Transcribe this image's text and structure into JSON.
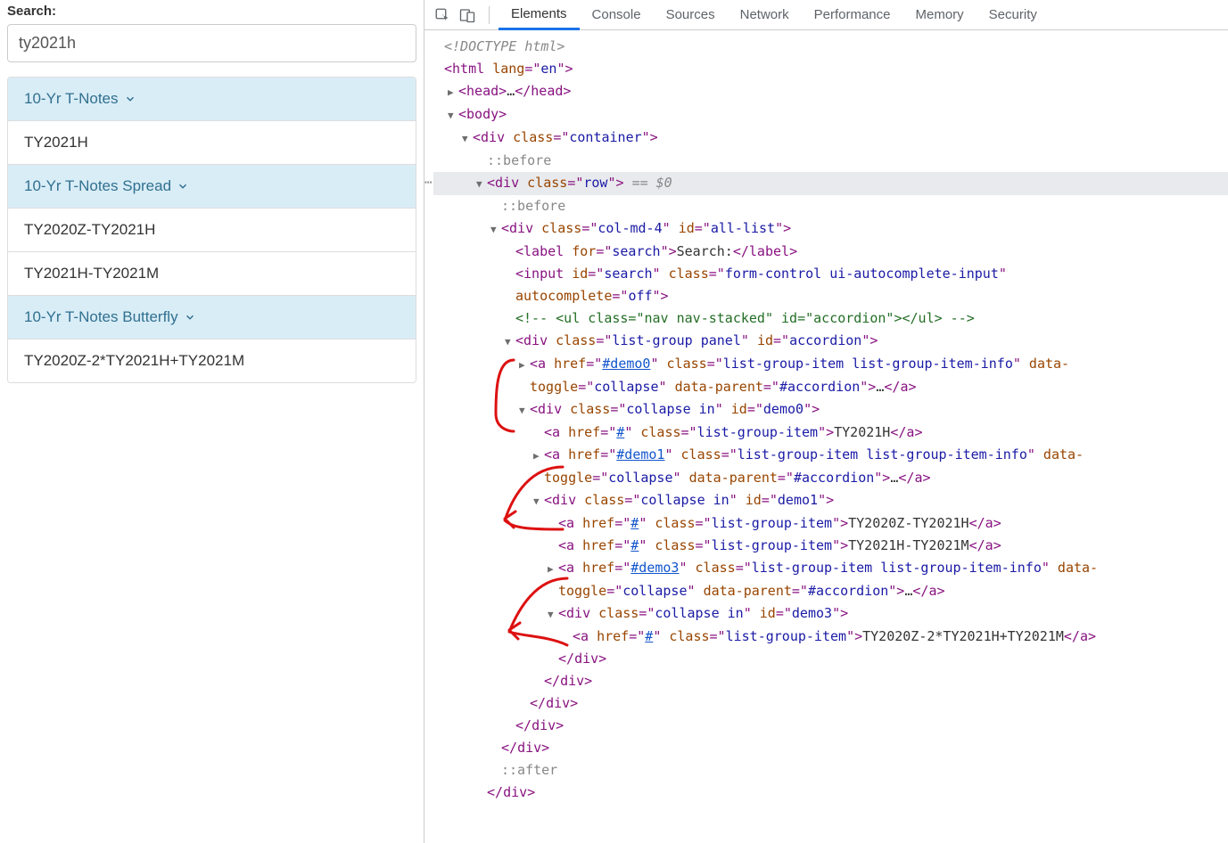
{
  "search": {
    "label": "Search:",
    "value": "ty2021h"
  },
  "accordion": {
    "groups": [
      {
        "header": "10-Yr T-Notes",
        "items": [
          "TY2021H"
        ]
      },
      {
        "header": "10-Yr T-Notes Spread",
        "items": [
          "TY2020Z-TY2021H",
          "TY2021H-TY2021M"
        ]
      },
      {
        "header": "10-Yr T-Notes Butterfly",
        "items": [
          "TY2020Z-2*TY2021H+TY2021M"
        ]
      }
    ]
  },
  "devtools": {
    "tabs": [
      "Elements",
      "Console",
      "Sources",
      "Network",
      "Performance",
      "Memory",
      "Security"
    ],
    "active_tab": "Elements",
    "selected_expr": "== $0"
  },
  "dom": {
    "doctype": "<!DOCTYPE html>",
    "html_lang": "en",
    "container_class": "container",
    "row_class": "row",
    "col_class": "col-md-4",
    "col_id": "all-list",
    "label_for": "search",
    "label_text": "Search:",
    "input_id": "search",
    "input_class": "form-control ui-autocomplete-input",
    "input_autocomplete": "off",
    "comment": "<!-- <ul class=\"nav nav-stacked\" id=\"accordion\"></ul> -->",
    "listgroup_class": "list-group panel",
    "listgroup_id": "accordion",
    "item_class_info": "list-group-item list-group-item-info",
    "item_class": "list-group-item",
    "collapse_class": "collapse in",
    "demo0_href": "#demo0",
    "demo0_id": "demo0",
    "demo1_href": "#demo1",
    "demo1_id": "demo1",
    "demo3_href": "#demo3",
    "demo3_id": "demo3",
    "data_toggle": "collapse",
    "data_parent": "#accordion",
    "hash": "#",
    "item0": "TY2021H",
    "item1a": "TY2020Z-TY2021H",
    "item1b": "TY2021H-TY2021M",
    "item3": "TY2020Z-2*TY2021H+TY2021M",
    "before": "::before",
    "after": "::after"
  }
}
